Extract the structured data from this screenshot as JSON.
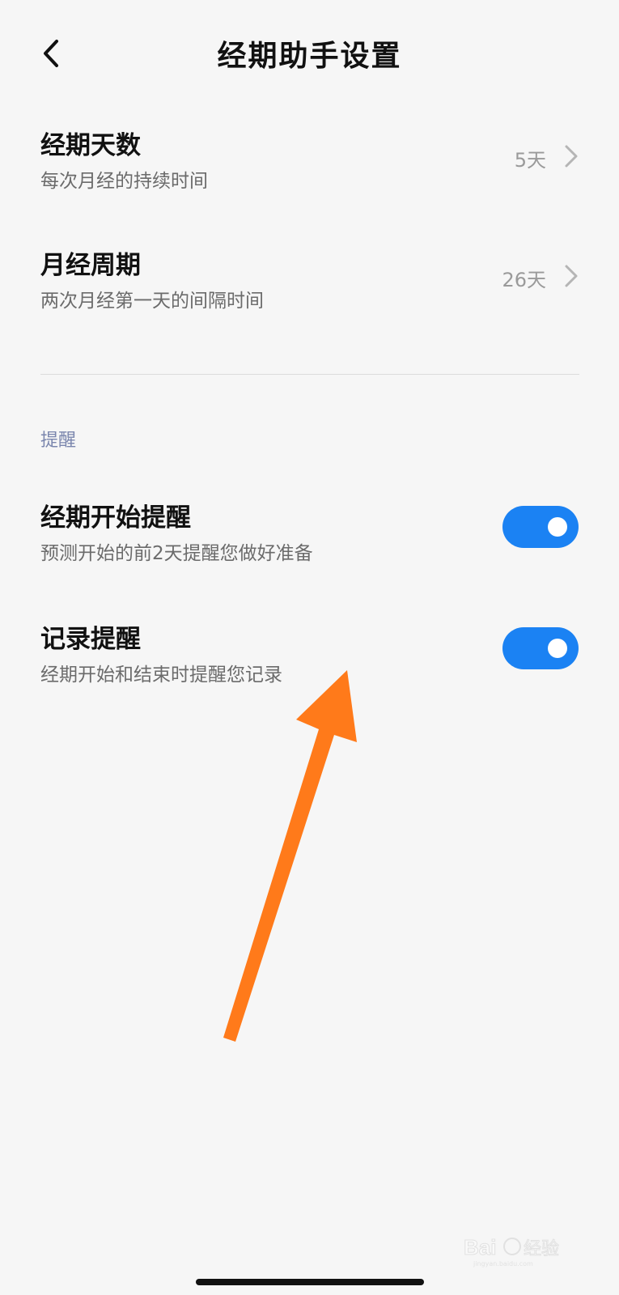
{
  "header": {
    "title": "经期助手设置",
    "back_icon": "chevron-left-icon"
  },
  "settings": [
    {
      "title": "经期天数",
      "subtitle": "每次月经的持续时间",
      "value": "5天",
      "icon": "chevron-right-icon"
    },
    {
      "title": "月经周期",
      "subtitle": "两次月经第一天的间隔时间",
      "value": "26天",
      "icon": "chevron-right-icon"
    }
  ],
  "reminders": {
    "section_title": "提醒",
    "items": [
      {
        "title": "经期开始提醒",
        "subtitle": "预测开始的前2天提醒您做好准备",
        "enabled": true
      },
      {
        "title": "记录提醒",
        "subtitle": "经期开始和结束时提醒您记录",
        "enabled": true
      }
    ]
  },
  "colors": {
    "background": "#f6f6f6",
    "toggle_on": "#1b82f3",
    "section_header": "#7a86ad",
    "annotation_arrow": "#ff7a1a"
  },
  "watermark": {
    "text": "Bai 经验",
    "subtext": "jingyan.baidu.com"
  }
}
